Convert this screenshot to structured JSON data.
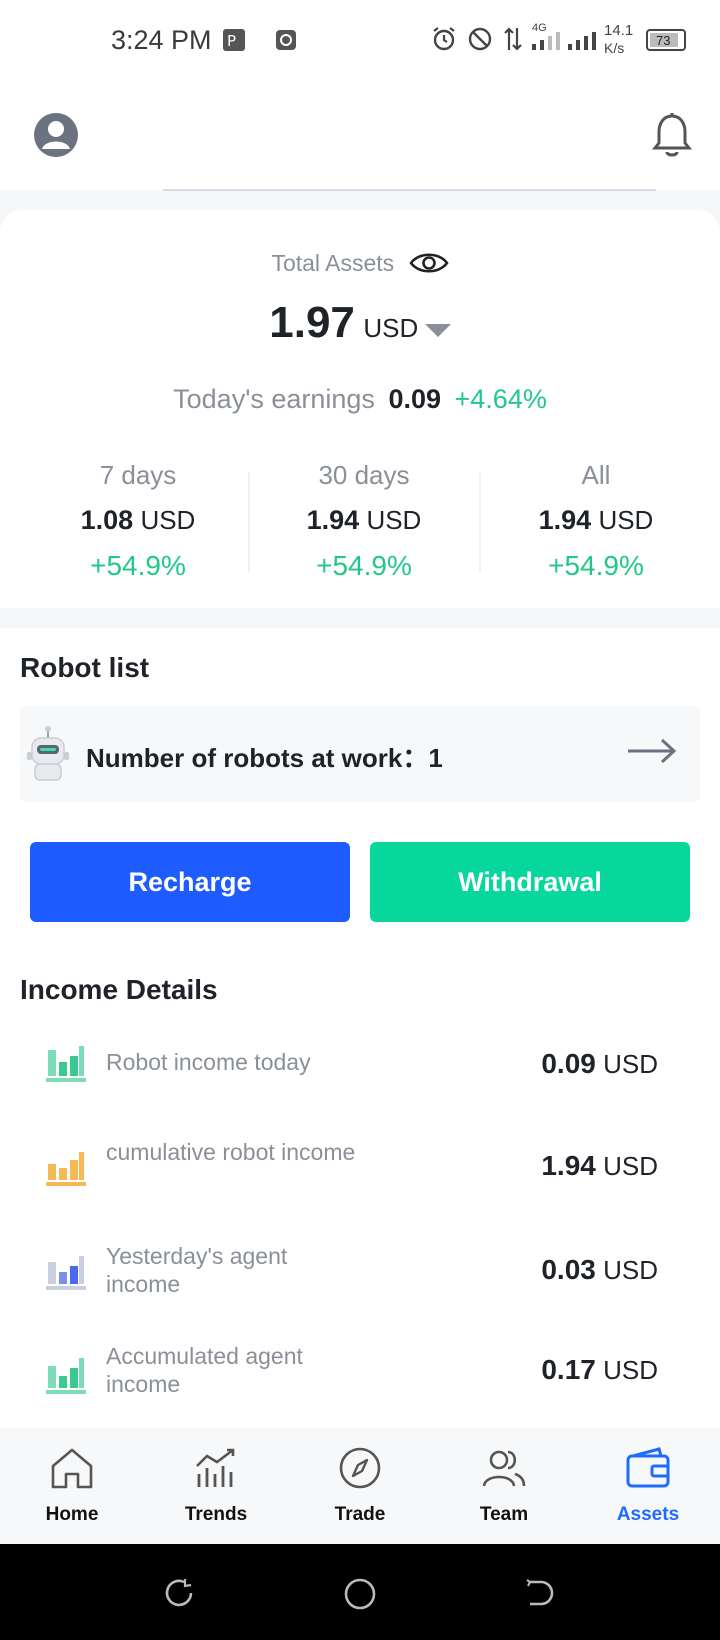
{
  "status_bar": {
    "time": "3:24 PM",
    "network": "4G",
    "speed_value": "14.1",
    "speed_unit": "K/s",
    "battery": "73"
  },
  "assets": {
    "total_label": "Total Assets",
    "total_value": "1.97",
    "currency": "USD",
    "today_label": "Today's earnings",
    "today_value": "0.09",
    "today_percent": "+4.64%",
    "periods": [
      {
        "label": "7 days",
        "value": "1.08",
        "unit": "USD",
        "percent": "+54.9%"
      },
      {
        "label": "30 days",
        "value": "1.94",
        "unit": "USD",
        "percent": "+54.9%"
      },
      {
        "label": "All",
        "value": "1.94",
        "unit": "USD",
        "percent": "+54.9%"
      }
    ]
  },
  "robots": {
    "title": "Robot list",
    "count_label": "Number of robots at work：",
    "count_value": "1"
  },
  "actions": {
    "recharge": "Recharge",
    "withdrawal": "Withdrawal"
  },
  "income": {
    "title": "Income Details",
    "items": [
      {
        "label": "Robot income today",
        "value": "0.09",
        "unit": "USD",
        "icon": "chart-icon-green"
      },
      {
        "label": "cumulative robot income",
        "value": "1.94",
        "unit": "USD",
        "icon": "chart-icon-orange"
      },
      {
        "label": "Yesterday's agent income",
        "value": "0.03",
        "unit": "USD",
        "icon": "chart-icon-blue"
      },
      {
        "label": "Accumulated agent income",
        "value": "0.17",
        "unit": "USD",
        "icon": "chart-icon-green"
      }
    ]
  },
  "tabs": [
    {
      "label": "Home",
      "icon": "home-icon"
    },
    {
      "label": "Trends",
      "icon": "trends-icon"
    },
    {
      "label": "Trade",
      "icon": "compass-icon"
    },
    {
      "label": "Team",
      "icon": "team-icon"
    },
    {
      "label": "Assets",
      "icon": "wallet-icon",
      "active": true
    }
  ],
  "colors": {
    "accent_blue": "#1e5cff",
    "accent_green": "#07d79c",
    "positive": "#22c88a",
    "muted": "#8a8f98"
  }
}
